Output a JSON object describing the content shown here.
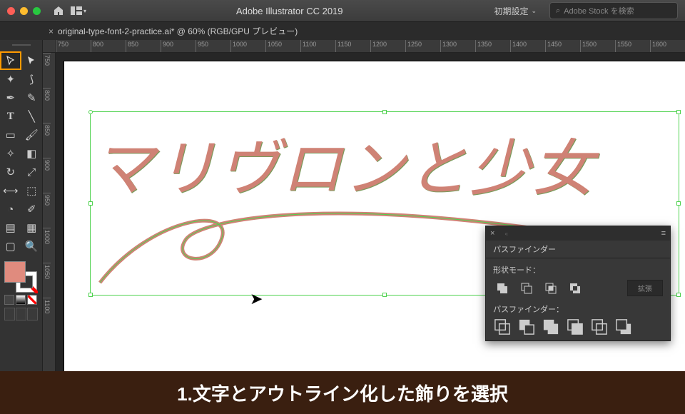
{
  "titlebar": {
    "app_title": "Adobe Illustrator CC 2019",
    "workspace": "初期設定",
    "search_placeholder": "Adobe Stock を検索"
  },
  "tab": {
    "filename": "original-type-font-2-practice.ai* @ 60% (RGB/GPU プレビュー)"
  },
  "ruler_h": [
    "750",
    "800",
    "850",
    "900",
    "950",
    "1000",
    "1050",
    "1100",
    "1150",
    "1200",
    "1250",
    "1300",
    "1350",
    "1400",
    "1450",
    "1500",
    "1550",
    "1600"
  ],
  "ruler_v": [
    "750",
    "800",
    "850",
    "900",
    "950",
    "1000",
    "1050",
    "1100"
  ],
  "artboard": {
    "text": "マリヴロンと少女"
  },
  "panel": {
    "title": "パスファインダー",
    "shape_mode_label": "形状モード：",
    "expand": "拡張",
    "pathfinder_label": "パスファインダー："
  },
  "caption": "1.文字とアウトライン化した飾りを選択",
  "tools": {
    "selection": "selection-tool",
    "direct": "direct-selection-tool"
  }
}
